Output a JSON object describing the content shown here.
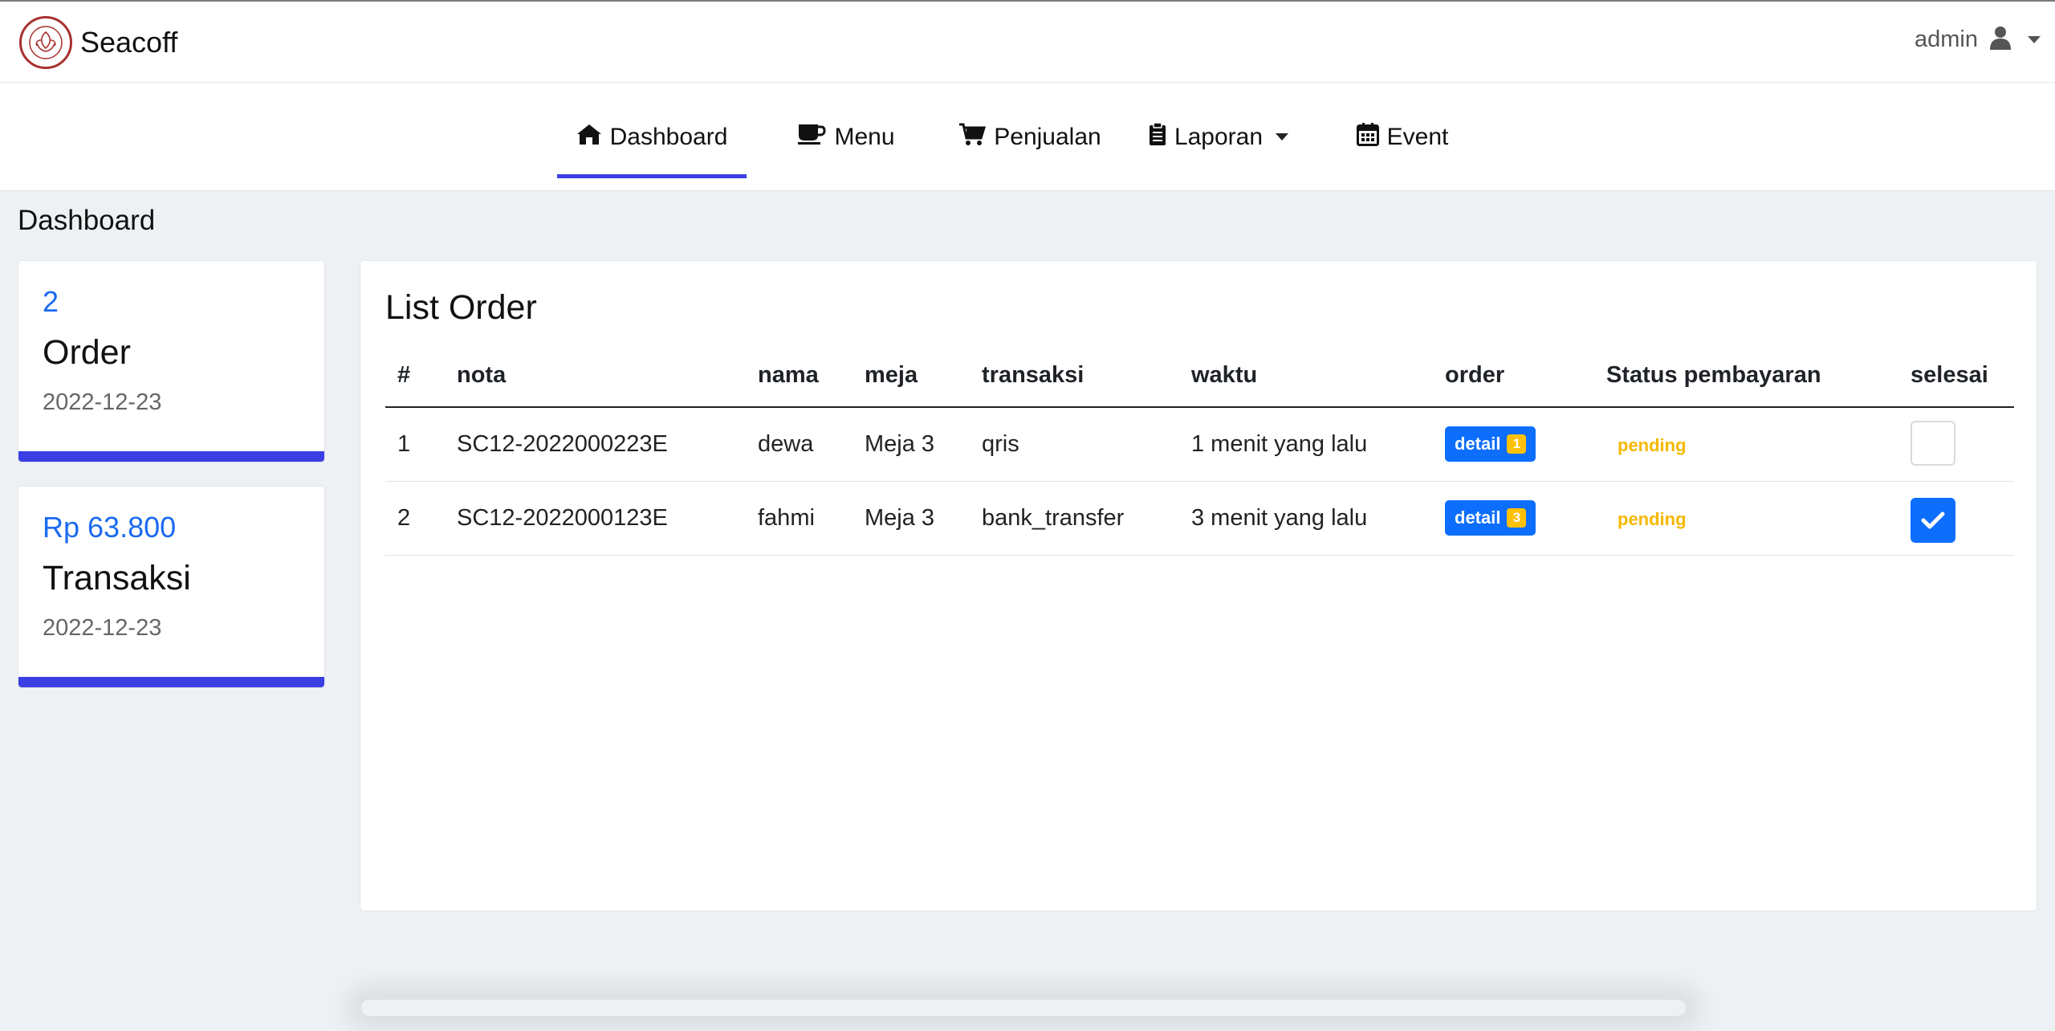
{
  "app": {
    "brand": "Seacoff",
    "user": "admin"
  },
  "nav": [
    {
      "label": "Dashboard",
      "icon": "home-icon",
      "active": true
    },
    {
      "label": "Menu",
      "icon": "coffee-icon",
      "active": false
    },
    {
      "label": "Penjualan",
      "icon": "cart-icon",
      "active": false
    },
    {
      "label": "Laporan",
      "icon": "clipboard-icon",
      "active": false,
      "dropdown": true
    },
    {
      "label": "Event",
      "icon": "calendar-icon",
      "active": false
    }
  ],
  "page": {
    "title": "Dashboard"
  },
  "stats": [
    {
      "value": "2",
      "label": "Order",
      "date": "2022-12-23"
    },
    {
      "value": "Rp 63.800",
      "label": "Transaksi",
      "date": "2022-12-23"
    }
  ],
  "orders": {
    "title": "List Order",
    "headers": [
      "#",
      "nota",
      "nama",
      "meja",
      "transaksi",
      "waktu",
      "order",
      "Status pembayaran",
      "selesai"
    ],
    "rows": [
      {
        "no": "1",
        "nota": "SC12-2022000223E",
        "nama": "dewa",
        "meja": "Meja 3",
        "transaksi": "qris",
        "waktu": "1 menit yang lalu",
        "detail_label": "detail",
        "detail_count": "1",
        "status": "pending",
        "selesai": false
      },
      {
        "no": "2",
        "nota": "SC12-2022000123E",
        "nama": "fahmi",
        "meja": "Meja 3",
        "transaksi": "bank_transfer",
        "waktu": "3 menit yang lalu",
        "detail_label": "detail",
        "detail_count": "3",
        "status": "pending",
        "selesai": true
      }
    ]
  },
  "colors": {
    "accent": "#3a3fe3",
    "primary": "#0d6efd",
    "warning": "#ffc107",
    "logo": "#a8312f"
  }
}
